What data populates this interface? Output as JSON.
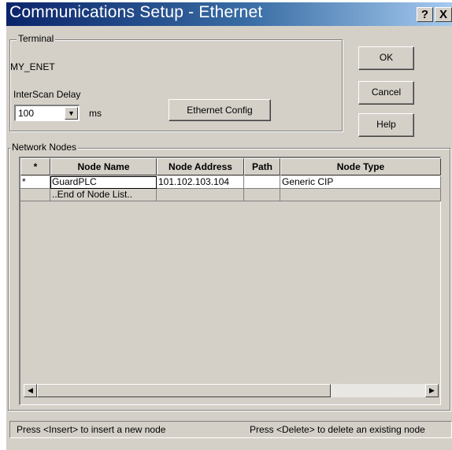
{
  "window": {
    "title": "Communications Setup - Ethernet",
    "help_glyph": "?",
    "close_glyph": "X"
  },
  "terminal": {
    "group_label": "Terminal",
    "name": "MY_ENET",
    "interscan_label": "InterScan Delay",
    "interscan_value": "100",
    "interscan_unit": "ms",
    "ethernet_config_label": "Ethernet Config"
  },
  "buttons": {
    "ok_label": "OK",
    "cancel_label": "Cancel",
    "help_label": "Help"
  },
  "network": {
    "group_label": "Network Nodes",
    "columns": [
      "*",
      "Node Name",
      "Node Address",
      "Path",
      "Node Type"
    ],
    "rows": [
      {
        "marker": "*",
        "node_name": "GuardPLC",
        "node_address": "101.102.103.104",
        "path": "",
        "node_type": "Generic CIP"
      },
      {
        "marker": "",
        "node_name": "..End of Node List..",
        "node_address": "",
        "path": "",
        "node_type": ""
      }
    ]
  },
  "status": {
    "insert_hint": "Press <Insert> to insert a new node",
    "delete_hint": "Press <Delete> to delete an existing node"
  },
  "icons": {
    "combo_arrow": "chevron-down-icon",
    "scroll_left": "arrow-left-icon",
    "scroll_right": "arrow-right-icon"
  },
  "colors": {
    "title_gradient_start": "#0a246a",
    "title_gradient_end": "#a6caf0",
    "dialog_face": "#d4d0c8"
  }
}
